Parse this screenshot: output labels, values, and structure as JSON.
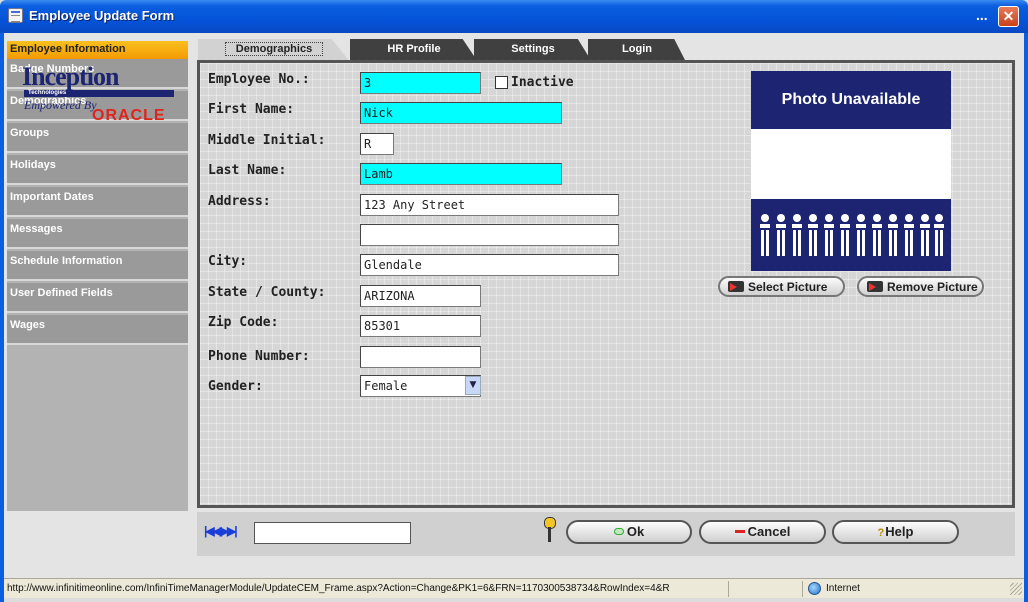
{
  "window": {
    "title": "Employee Update Form",
    "ellipsis": "...",
    "close_glyph": "✕"
  },
  "sidebar": {
    "items": [
      {
        "label": "Employee Information",
        "active": true
      },
      {
        "label": "Badge Numbers"
      },
      {
        "label": "Demographics"
      },
      {
        "label": "Groups"
      },
      {
        "label": "Holidays"
      },
      {
        "label": "Important Dates"
      },
      {
        "label": "Messages"
      },
      {
        "label": "Schedule Information"
      },
      {
        "label": "User Defined Fields"
      },
      {
        "label": "Wages"
      }
    ]
  },
  "tabs": [
    {
      "label": "Demographics",
      "active": true
    },
    {
      "label": "HR Profile"
    },
    {
      "label": "Settings"
    },
    {
      "label": "Login"
    }
  ],
  "form": {
    "employee_no_label": "Employee No.:",
    "employee_no": "3",
    "inactive_label": "Inactive",
    "inactive_checked": false,
    "first_name_label": "First Name:",
    "first_name": "Nick",
    "middle_initial_label": "Middle Initial:",
    "middle_initial": "R",
    "last_name_label": "Last Name:",
    "last_name": "Lamb",
    "address_label": "Address:",
    "address1": "123 Any Street",
    "address2": "",
    "city_label": "City:",
    "city": "Glendale",
    "state_label": "State / County:",
    "state": "ARIZONA",
    "zip_label": "Zip Code:",
    "zip": "85301",
    "phone_label": "Phone Number:",
    "phone": "",
    "gender_label": "Gender:",
    "gender": "Female"
  },
  "photo": {
    "unavailable_text": "Photo Unavailable",
    "brand": "Inception",
    "brand_sub": "Technologies",
    "empowered_by": "Empowered By",
    "oracle": "ORACLE",
    "select_label": "Select Picture",
    "remove_label": "Remove Picture"
  },
  "footer": {
    "nav_arrows": "|◀◀▶▶|",
    "record_value": "",
    "ok_label": "Ok",
    "cancel_label": "Cancel",
    "help_label": "Help",
    "help_glyph": "?"
  },
  "statusbar": {
    "url": "http://www.infinitimeonline.com/InfiniTimeManagerModule/UpdateCEM_Frame.aspx?Action=Change&PK1=6&FRN=1170300538734&RowIndex=4&R",
    "zone": "Internet"
  },
  "colors": {
    "required_field": "#00ffff",
    "active_nav": "#f3a800",
    "titlebar": "#0551d6",
    "photo_bg": "#1d2573",
    "oracle_red": "#e2231a"
  },
  "icons": {
    "window_icon": "form-icon",
    "close": "close-icon",
    "key": "key-icon",
    "globe": "globe-icon",
    "nav": "record-navigation-icon"
  }
}
